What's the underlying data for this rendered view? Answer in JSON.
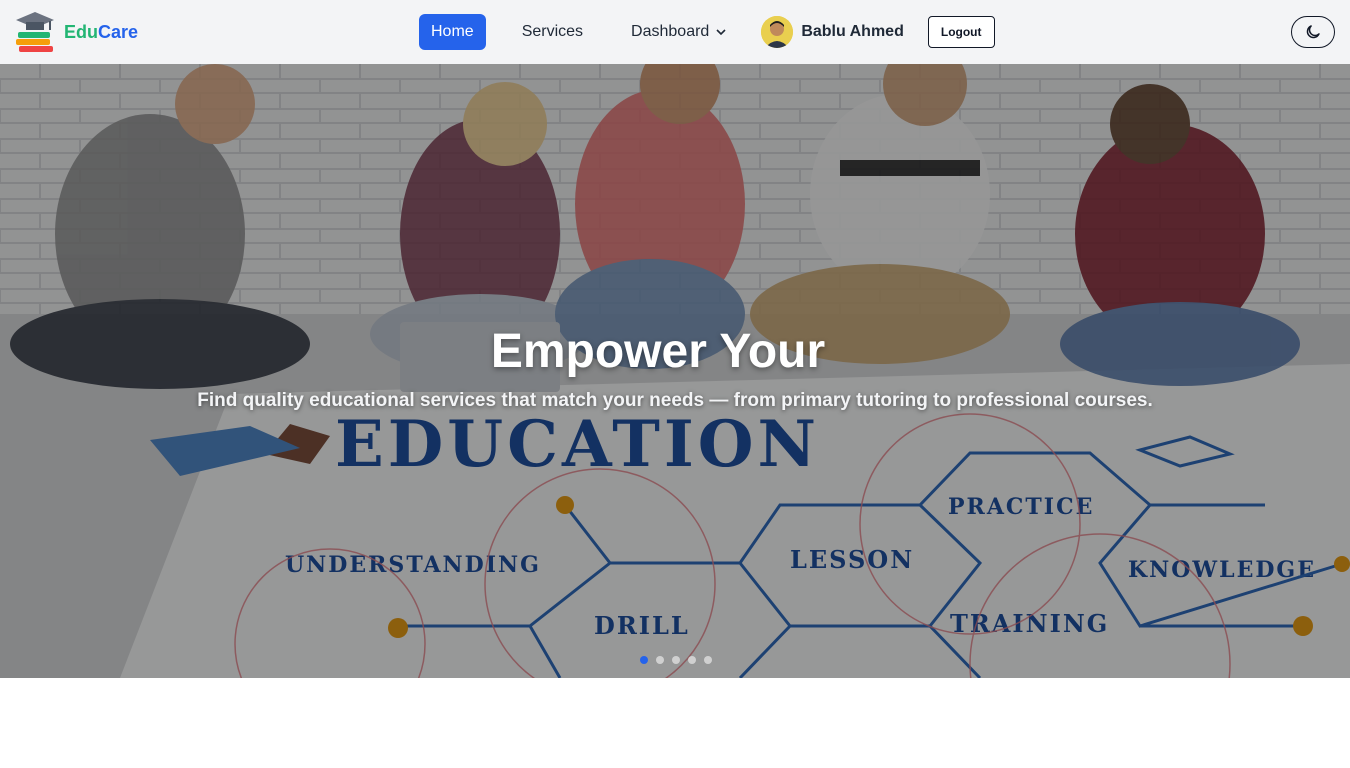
{
  "brand": {
    "part1": "Edu",
    "part2": "Care",
    "logo_icon": "graduation-books-logo"
  },
  "nav": {
    "home": "Home",
    "services": "Services",
    "dashboard": "Dashboard",
    "user_name": "Bablu Ahmed",
    "logout": "Logout",
    "theme_icon": "moon-icon"
  },
  "hero": {
    "title": "Empower Your",
    "subtitle": "Find quality educational services that match your needs — from primary tutoring to professional courses.",
    "slide_count": 5,
    "active_slide": 1,
    "image_words": [
      "EDUCATION",
      "UNDERSTANDING",
      "DRILL",
      "LESSON",
      "PRACTICE",
      "TRAINING",
      "KNOWLEDGE"
    ]
  },
  "colors": {
    "accent": "#2563eb",
    "brand_green": "#22b573",
    "nav_bg": "#f3f4f6"
  }
}
